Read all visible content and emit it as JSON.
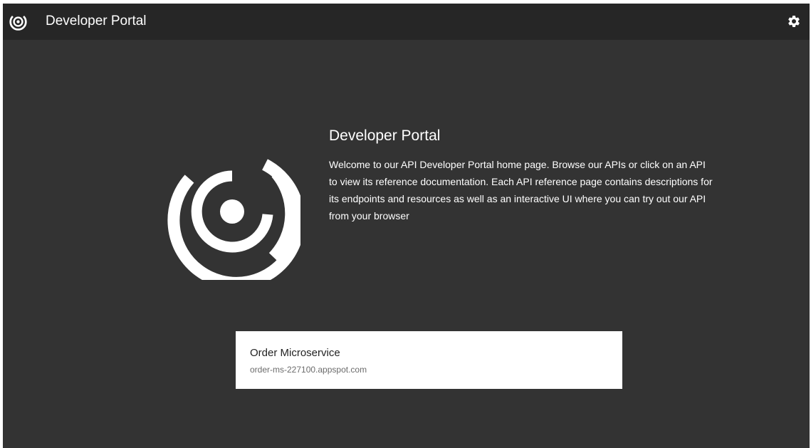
{
  "topbar": {
    "logo_icon": "portal-logo-icon",
    "title": "Developer Portal",
    "settings_icon": "gear-icon"
  },
  "hero": {
    "logo_icon": "portal-logo-icon",
    "title": "Developer Portal",
    "description": "Welcome to our API Developer Portal home page. Browse our APIs or click on an API to view its reference documentation. Each API reference page contains descriptions for its endpoints and resources as well as an interactive UI where you can try out our API from your browser"
  },
  "apis": [
    {
      "name": "Order Microservice",
      "host": "order-ms-227100.appspot.com"
    }
  ],
  "colors": {
    "background": "#333333",
    "topbar": "#262626",
    "text_light": "#ffffff",
    "card": "#ffffff"
  }
}
